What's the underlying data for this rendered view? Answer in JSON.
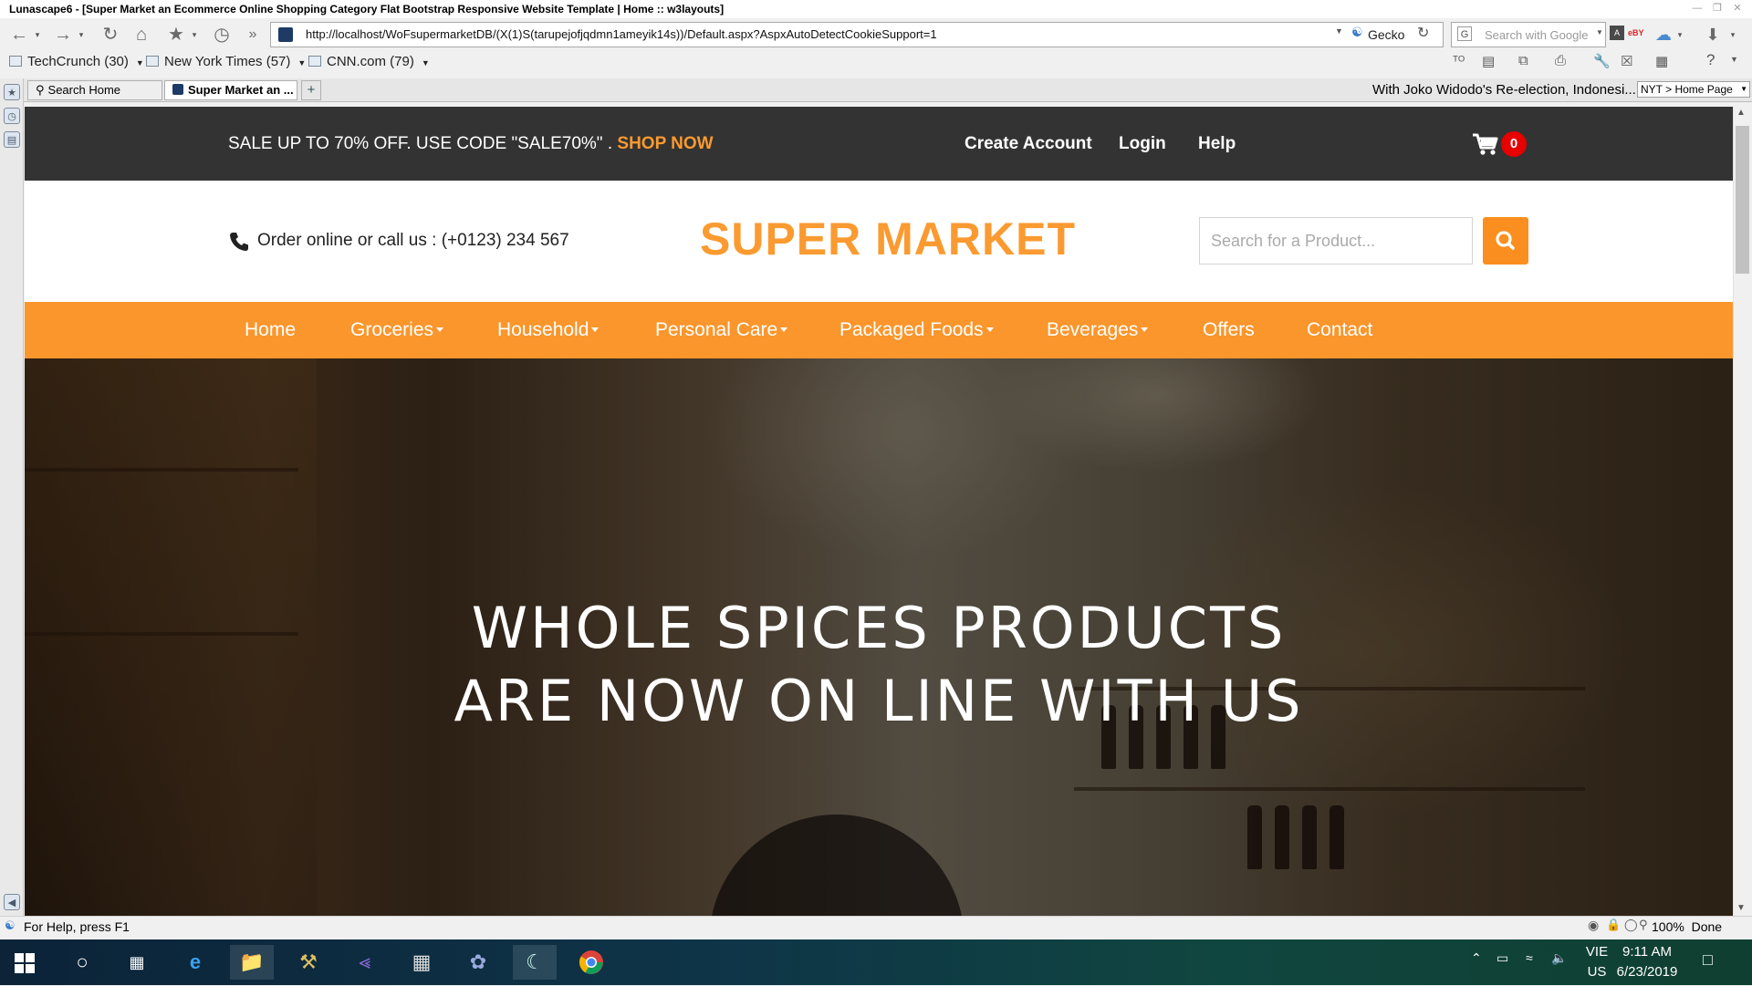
{
  "window": {
    "title": "Lunascape6 - [Super Market an Ecommerce Online Shopping Category Flat Bootstrap Responsive Website Template | Home :: w3layouts]"
  },
  "toolbar": {
    "url": "http://localhost/WoFsupermarketDB/(X(1)S(tarupejofjqdmn1ameyik14s))/Default.aspx?AspxAutoDetectCookieSupport=1",
    "engine_label": "Gecko",
    "search_placeholder": "Search with Google"
  },
  "bookmarks": [
    {
      "label": "TechCrunch (30)"
    },
    {
      "label": "New York Times (57)"
    },
    {
      "label": "CNN.com (79)"
    }
  ],
  "tabs": [
    {
      "label": "Search Home"
    },
    {
      "label": "Super Market an ..."
    }
  ],
  "ticker": {
    "headline": "With Joko Widodo's Re-election, Indonesi...",
    "feed_label": "NYT > Home Page"
  },
  "site": {
    "sale_text": "SALE UP TO 70% OFF. USE CODE \"SALE70%\" . ",
    "shop_now": "SHOP NOW",
    "create_account": "Create Account",
    "login": "Login",
    "help": "Help",
    "cart_count": "0",
    "order_text": "Order online or call us : (+0123) 234 567",
    "logo": "SUPER MARKET",
    "search_placeholder": "Search for a Product...",
    "menu": [
      {
        "label": "Home"
      },
      {
        "label": "Groceries"
      },
      {
        "label": "Household"
      },
      {
        "label": "Personal Care"
      },
      {
        "label": "Packaged Foods"
      },
      {
        "label": "Beverages"
      },
      {
        "label": "Offers"
      },
      {
        "label": "Contact"
      }
    ],
    "hero_line1": "WHOLE SPICES PRODUCTS",
    "hero_line2": "ARE NOW ON LINE WITH US"
  },
  "status": {
    "help_text": "For Help, press F1",
    "zoom": "100%",
    "state": "Done"
  },
  "taskbar": {
    "lang_line1": "VIE",
    "lang_line2": "US",
    "time": "9:11 AM",
    "date": "6/23/2019"
  },
  "colors": {
    "accent_orange": "#fa962c",
    "top_strip": "#333333",
    "cart_badge": "#e60000"
  }
}
